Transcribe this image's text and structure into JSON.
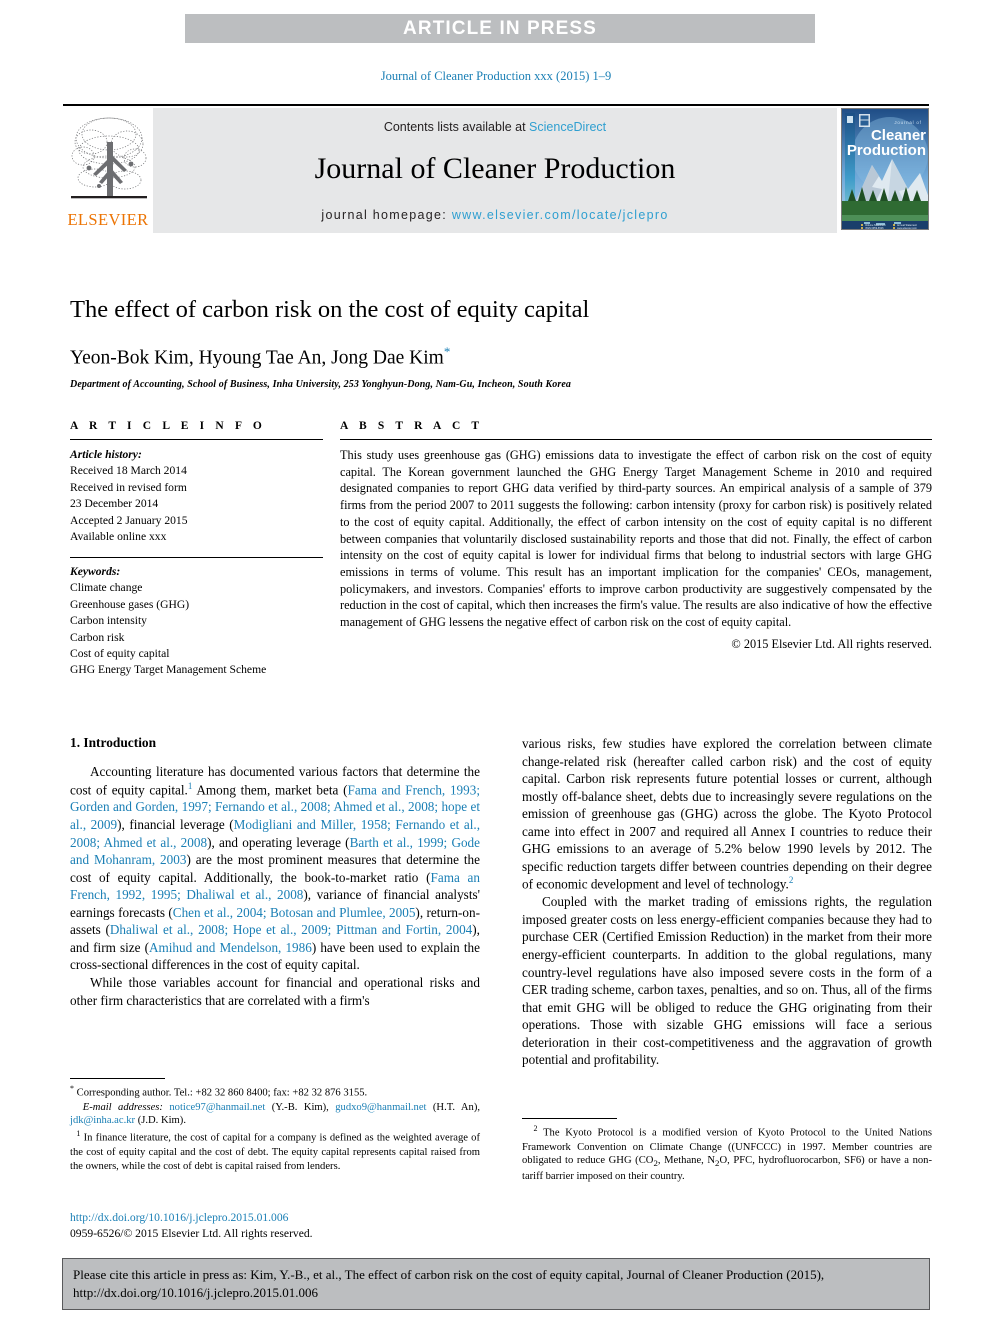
{
  "banner": {
    "text": "ARTICLE IN PRESS"
  },
  "running_head": "Journal of Cleaner Production xxx (2015) 1–9",
  "masthead": {
    "contents_prefix": "Contents lists available at ",
    "sciencedirect": "ScienceDirect",
    "journal_name": "Journal of Cleaner Production",
    "homepage_label": "journal homepage: ",
    "homepage_url": "www.elsevier.com/locate/jclepro",
    "publisher": "ELSEVIER",
    "cover_title_small": "Journal of",
    "cover_title_1": "Cleaner",
    "cover_title_2": "Production"
  },
  "article": {
    "title": "The effect of carbon risk on the cost of equity capital",
    "authors": "Yeon-Bok Kim, Hyoung Tae An, Jong Dae Kim",
    "corresponding_marker": "*",
    "affiliation": "Department of Accounting, School of Business, Inha University, 253 Yonghyun-Dong, Nam-Gu, Incheon, South Korea"
  },
  "article_info": {
    "heading": "A R T I C L E   I N F O",
    "history_label": "Article history:",
    "history_lines": [
      "Received 18 March 2014",
      "Received in revised form",
      "23 December 2014",
      "Accepted 2 January 2015",
      "Available online xxx"
    ],
    "keywords_label": "Keywords:",
    "keywords": [
      "Climate change",
      "Greenhouse gases (GHG)",
      "Carbon intensity",
      "Carbon risk",
      "Cost of equity capital",
      "GHG Energy Target Management Scheme"
    ]
  },
  "abstract": {
    "heading": "A B S T R A C T",
    "text": "This study uses greenhouse gas (GHG) emissions data to investigate the effect of carbon risk on the cost of equity capital. The Korean government launched the GHG Energy Target Management Scheme in 2010 and required designated companies to report GHG data verified by third-party sources. An empirical analysis of a sample of 379 firms from the period 2007 to 2011 suggests the following: carbon intensity (proxy for carbon risk) is positively related to the cost of equity capital. Additionally, the effect of carbon intensity on the cost of equity capital is no different between companies that voluntarily disclosed sustainability reports and those that did not. Finally, the effect of carbon intensity on the cost of equity capital is lower for individual firms that belong to industrial sectors with large GHG emissions in terms of volume. This result has an important implication for the companies' CEOs, management, policymakers, and investors. Companies' efforts to improve carbon productivity are suggestively compensated by the reduction in the cost of capital, which then increases the firm's value. The results are also indicative of how the effective management of GHG lessens the negative effect of carbon risk on the cost of equity capital.",
    "copyright": "© 2015 Elsevier Ltd. All rights reserved."
  },
  "body": {
    "section_heading": "1. Introduction",
    "left_paragraph_1_a": "Accounting literature has documented various factors that determine the cost of equity capital.",
    "left_paragraph_1_b": " Among them, market beta (",
    "ref1": "Fama and French, 1993; Gorden and Gorden, 1997; Fernando et al., 2008; Ahmed et al., 2008; hope et al., 2009",
    "left_paragraph_1_c": "), financial leverage (",
    "ref2": "Modigliani and Miller, 1958; Fernando et al., 2008; Ahmed et al., 2008",
    "left_paragraph_1_d": "), and operating leverage (",
    "ref3": "Barth et al., 1999; Gode and Mohanram, 2003",
    "left_paragraph_1_e": ") are the most prominent measures that determine the cost of equity capital. Additionally, the book-to-market ratio (",
    "ref4": "Fama an French, 1992, 1995; Dhaliwal et al., 2008",
    "left_paragraph_1_f": "), variance of financial analysts' earnings forecasts (",
    "ref5": "Chen et al., 2004; Botosan and Plumlee, 2005",
    "left_paragraph_1_g": "), return-on-assets (",
    "ref6": "Dhaliwal et al., 2008; Hope et al., 2009; Pittman and Fortin, 2004",
    "left_paragraph_1_h": "), and firm size (",
    "ref7": "Amihud and Mendelson, 1986",
    "left_paragraph_1_i": ") have been used to explain the cross-sectional differences in the cost of equity capital.",
    "left_paragraph_2": "While those variables account for financial and operational risks and other firm characteristics that are correlated with a firm's",
    "right_paragraph_1_a": "various risks, few studies have explored the correlation between climate change-related risk (hereafter called carbon risk) and the cost of equity capital. Carbon risk represents future potential losses or current, although mostly off-balance sheet, debts due to increasingly severe regulations on the emission of greenhouse gas (GHG) across the globe. The Kyoto Protocol came into effect in 2007 and required all Annex I countries to reduce their GHG emissions to an average of 5.2% below 1990 levels by 2012. The specific reduction targets differ between countries depending on their degree of economic development and level of technology.",
    "right_paragraph_2": "Coupled with the market trading of emissions rights, the regulation imposed greater costs on less energy-efficient companies because they had to purchase CER (Certified Emission Reduction) in the market from their more energy-efficient counterparts. In addition to the global regulations, many country-level regulations have also imposed severe costs in the form of a CER trading scheme, carbon taxes, penalties, and so on. Thus, all of the firms that emit GHG will be obliged to reduce the GHG originating from their operations. Those with sizable GHG emissions will face a serious deterioration in their cost-competitiveness and the aggravation of growth potential and profitability."
  },
  "footnotes": {
    "corresponding_author": "Corresponding author. Tel.: +82 32 860 8400; fax: +82 32 876 3155.",
    "email_label": "E-mail addresses:",
    "email1": "notice97@hanmail.net",
    "email1_owner": "(Y.-B. Kim),",
    "email2": "gudxo9@hanmail.net",
    "email2_owner": "(H.T. An),",
    "email3": "jdk@inha.ac.kr",
    "email3_owner": "(J.D. Kim).",
    "fn1_mark": "1",
    "fn1_text": "In finance literature, the cost of capital for a company is defined as the weighted average of the cost of equity capital and the cost of debt. The equity capital represents capital raised from the owners, while the cost of debt is capital raised from lenders.",
    "fn2_mark": "2",
    "fn2_text_a": "The Kyoto Protocol is a modified version of Kyoto Protocol to the United Nations Framework Convention on Climate Change ((UNFCCC) in 1997. Member countries are obligated to reduce GHG (CO",
    "fn2_sub1": "2",
    "fn2_text_b": ", Methane, N",
    "fn2_sub2": "2",
    "fn2_text_c": "O, PFC, hydrofluorocarbon, SF6) or have a non-tariff barrier imposed on their country."
  },
  "doi": {
    "url": "http://dx.doi.org/10.1016/j.jclepro.2015.01.006",
    "issn_line": "0959-6526/© 2015 Elsevier Ltd. All rights reserved."
  },
  "cite_box": {
    "line1": "Please cite this article in press as: Kim, Y.-B., et al., The effect of carbon risk on the cost of equity capital, Journal of Cleaner Production (2015),",
    "line2": "http://dx.doi.org/10.1016/j.jclepro.2015.01.006"
  },
  "colors": {
    "link_blue": "#1a7fb5",
    "sd_blue": "#2f9fd0",
    "banner_gray": "#bcbec0",
    "masthead_gray": "#e6e7e8",
    "elsevier_orange": "#ec7404"
  }
}
